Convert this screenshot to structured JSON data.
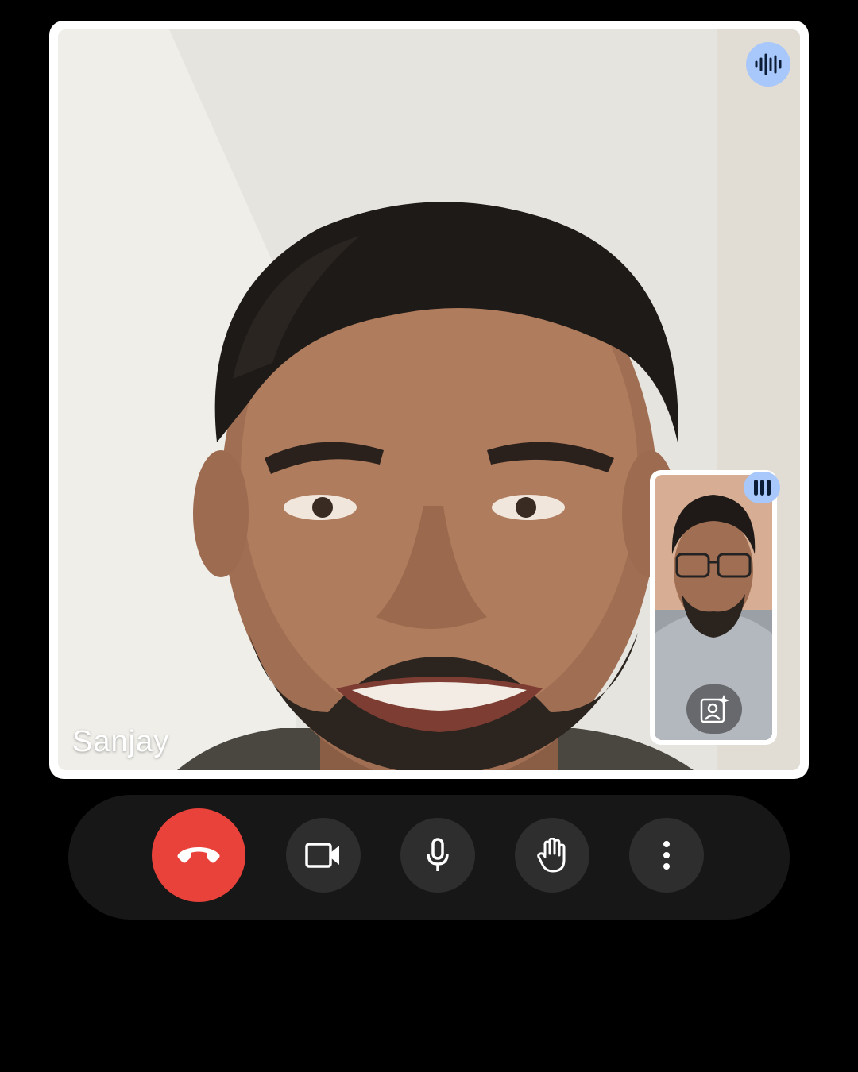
{
  "call": {
    "participant_name": "Sanjay"
  },
  "icons": {
    "speaking": "audio-wave-icon",
    "self_speaking": "audio-bars-icon",
    "effects": "portrait-sparkle-icon",
    "hangup": "phone-hangup-icon",
    "camera": "videocam-icon",
    "mic": "mic-icon",
    "raise_hand": "hand-icon",
    "more": "more-vert-icon"
  },
  "colors": {
    "accent": "#a8c7fa",
    "hangup": "#e9423a",
    "control_bg": "#2e2e2e",
    "bar_bg": "#171717"
  }
}
